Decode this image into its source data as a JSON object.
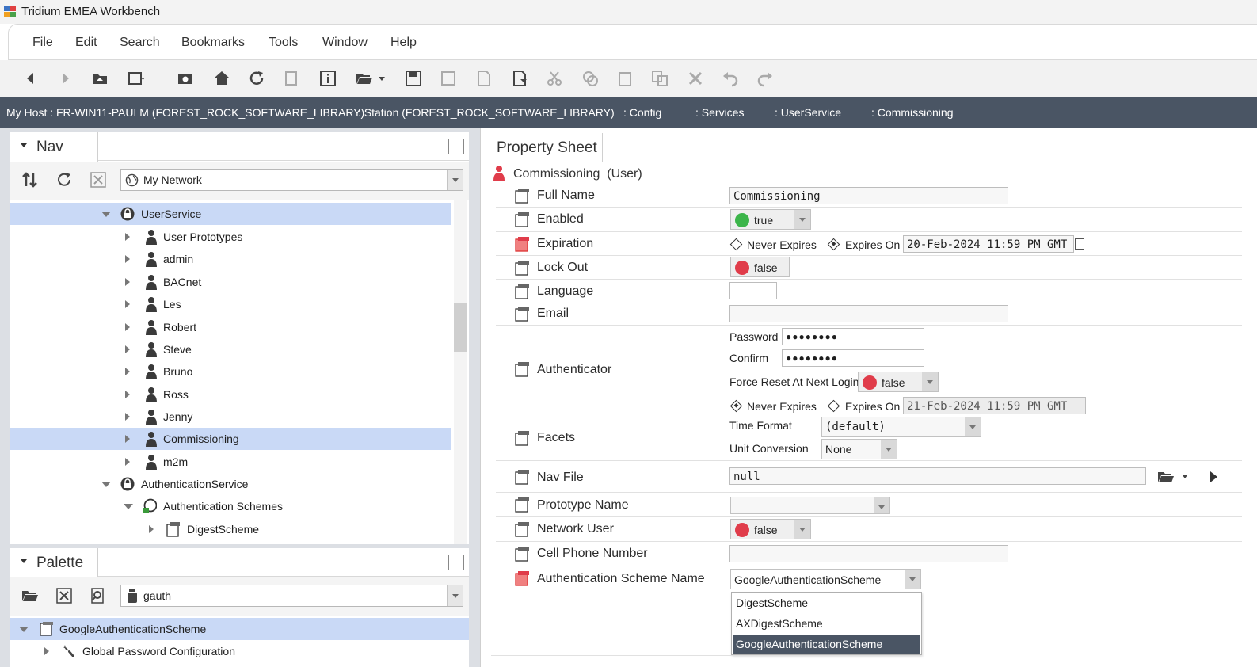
{
  "window": {
    "title": "Tridium EMEA Workbench"
  },
  "menu": [
    "File",
    "Edit",
    "Search",
    "Bookmarks",
    "Tools",
    "Window",
    "Help"
  ],
  "breadcrumb": [
    "My Host : FR-WIN11-PAULM (FOREST_ROCK_SOFTWARE_LIBRARY)",
    ": Station (FOREST_ROCK_SOFTWARE_LIBRARY)",
    ": Config",
    ": Services",
    ": UserService",
    ": Commissioning"
  ],
  "nav": {
    "title": "Nav",
    "network_combo": "My Network",
    "tree": [
      {
        "label": "UserService",
        "selected": true
      },
      {
        "label": "User Prototypes"
      },
      {
        "label": "admin"
      },
      {
        "label": "BACnet"
      },
      {
        "label": "Les"
      },
      {
        "label": "Robert"
      },
      {
        "label": "Steve"
      },
      {
        "label": "Bruno"
      },
      {
        "label": "Ross"
      },
      {
        "label": "Jenny"
      },
      {
        "label": "Commissioning",
        "selected": true
      },
      {
        "label": "m2m"
      },
      {
        "label": "AuthenticationService"
      },
      {
        "label": "Authentication Schemes"
      },
      {
        "label": "DigestScheme"
      }
    ]
  },
  "palette": {
    "title": "Palette",
    "search_combo": "gauth",
    "tree": [
      {
        "label": "GoogleAuthenticationScheme",
        "selected": true
      },
      {
        "label": "Global Password Configuration"
      }
    ]
  },
  "property_sheet": {
    "tab": "Property Sheet",
    "header": "Commissioning  (User)",
    "full_name": {
      "label": "Full Name",
      "value": "Commissioning"
    },
    "enabled": {
      "label": "Enabled",
      "value": "true"
    },
    "expiration": {
      "label": "Expiration",
      "never": "Never Expires",
      "expires_on": "Expires On",
      "date": "20-Feb-2024 11:59 PM GMT"
    },
    "lock_out": {
      "label": "Lock Out",
      "value": "false"
    },
    "language": {
      "label": "Language",
      "value": ""
    },
    "email": {
      "label": "Email",
      "value": ""
    },
    "authenticator": {
      "label": "Authenticator",
      "password_label": "Password",
      "password": "●●●●●●●●",
      "confirm_label": "Confirm",
      "confirm": "●●●●●●●●",
      "force_reset_label": "Force Reset At Next Login",
      "force_reset": "false",
      "never": "Never Expires",
      "expires_on": "Expires On",
      "date": "21-Feb-2024 11:59 PM GMT"
    },
    "facets": {
      "label": "Facets",
      "time_format_label": "Time Format",
      "time_format": "(default)",
      "unit_conv_label": "Unit Conversion",
      "unit_conv": "None"
    },
    "nav_file": {
      "label": "Nav File",
      "value": "null"
    },
    "prototype_name": {
      "label": "Prototype Name",
      "value": ""
    },
    "network_user": {
      "label": "Network User",
      "value": "false"
    },
    "cell_phone": {
      "label": "Cell Phone Number",
      "value": ""
    },
    "auth_scheme": {
      "label": "Authentication Scheme Name",
      "value": "GoogleAuthenticationScheme",
      "options": [
        "DigestScheme",
        "AXDigestScheme",
        "GoogleAuthenticationScheme"
      ]
    }
  },
  "colors": {
    "pathbar": "#4a5564",
    "selection": "#c9d9f6",
    "true_dot": "#3cb54a",
    "false_dot": "#e03c4a"
  }
}
